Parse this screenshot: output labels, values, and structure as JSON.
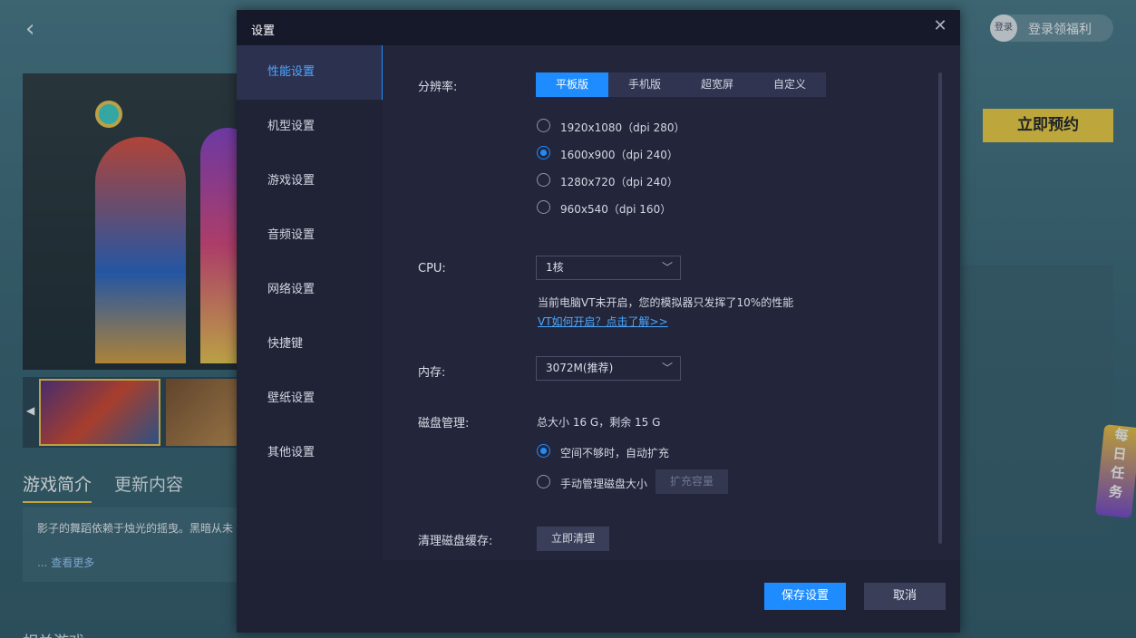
{
  "background": {
    "login_avatar": "登录",
    "login_text": "登录领福利",
    "reserve_button": "立即预约",
    "daily_task": [
      "每",
      "日",
      "任",
      "务"
    ],
    "tabs": [
      "游戏简介",
      "更新内容"
    ],
    "intro_text": "影子的舞蹈依赖于烛光的摇曳。黑暗从未",
    "see_more": "... 查看更多",
    "related_title": "相关游戏"
  },
  "modal": {
    "title": "设置",
    "sidebar": [
      "性能设置",
      "机型设置",
      "游戏设置",
      "音频设置",
      "网络设置",
      "快捷键",
      "壁纸设置",
      "其他设置"
    ],
    "active_index": 0,
    "resolution": {
      "label": "分辨率:",
      "tabs": [
        "平板版",
        "手机版",
        "超宽屏",
        "自定义"
      ],
      "active_tab": 0,
      "options": [
        "1920x1080（dpi 280）",
        "1600x900（dpi 240）",
        "1280x720（dpi 240）",
        "960x540（dpi 160）"
      ],
      "selected": 1
    },
    "cpu": {
      "label": "CPU:",
      "value": "1核",
      "hint": "当前电脑VT未开启，您的模拟器只发挥了10%的性能",
      "link": "VT如何开启？点击了解>>"
    },
    "memory": {
      "label": "内存:",
      "value": "3072M(推荐)"
    },
    "disk": {
      "label": "磁盘管理:",
      "info": "总大小 16 G，剩余 15 G",
      "options": [
        "空间不够时，自动扩充",
        "手动管理磁盘大小"
      ],
      "selected": 0,
      "expand_button": "扩充容量"
    },
    "cache": {
      "label": "清理磁盘缓存:",
      "button": "立即清理"
    },
    "save_button": "保存设置",
    "cancel_button": "取消"
  },
  "colors": {
    "accent": "#1e8cff",
    "reserve": "#f6d23f",
    "modal_bg": "#23263a"
  }
}
